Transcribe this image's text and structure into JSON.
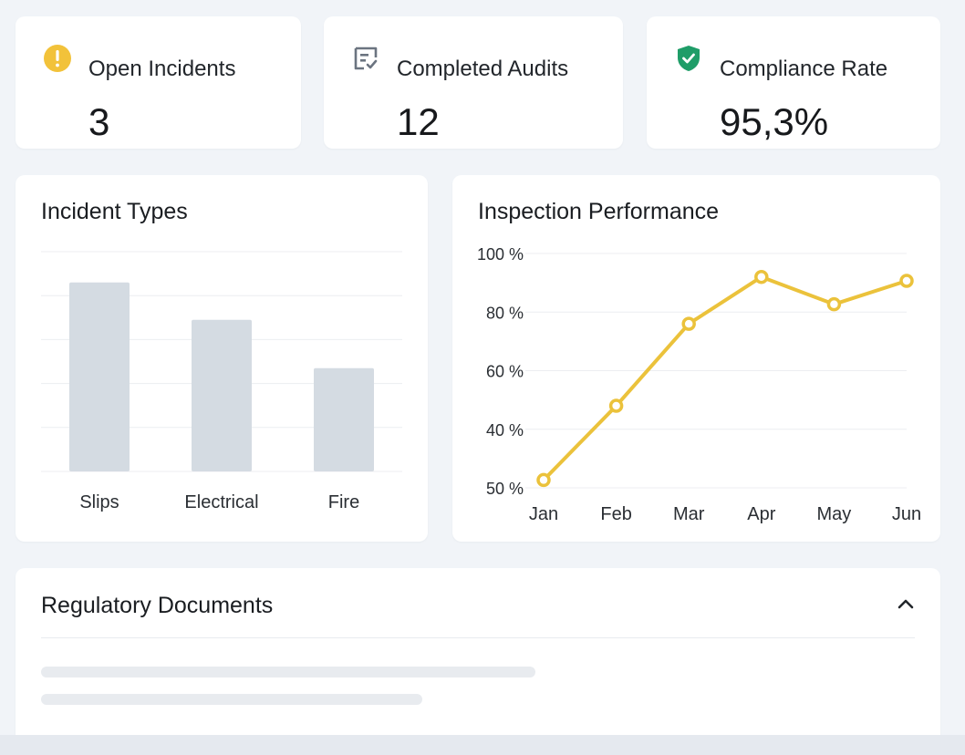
{
  "stats": {
    "open_incidents": {
      "label": "Open Incidents",
      "value": "3",
      "icon": "warning-icon",
      "color": "#f2c23a"
    },
    "completed_audits": {
      "label": "Completed Audits",
      "value": "12",
      "icon": "audit-checklist-icon",
      "color": "#6b7480"
    },
    "compliance_rate": {
      "label": "Compliance Rate",
      "value": "95,3%",
      "icon": "shield-check-icon",
      "color": "#1f9d68"
    }
  },
  "incident_types": {
    "title": "Incident Types"
  },
  "inspection": {
    "title": "Inspection Performance"
  },
  "documents": {
    "title": "Regulatory Documents",
    "chevron_icon": "chevron-up-icon"
  },
  "chart_data": [
    {
      "type": "bar",
      "title": "Incident Types",
      "categories": [
        "Slips",
        "Electrical",
        "Fire"
      ],
      "values": [
        4.3,
        3.45,
        2.35
      ],
      "ylim": [
        0,
        5
      ],
      "grid": true,
      "bar_color": "#d4dbe2"
    },
    {
      "type": "line",
      "title": "Inspection Performance",
      "x": [
        "Jan",
        "Feb",
        "Mar",
        "Apr",
        "May",
        "Jun"
      ],
      "ytick_labels": [
        "100 %",
        "80 %",
        "60 %",
        "40 %",
        "50 %"
      ],
      "values": [
        42,
        61,
        82,
        94,
        87,
        93
      ],
      "ylim": [
        40,
        100
      ],
      "grid": true,
      "line_color": "#ebc23b"
    }
  ]
}
